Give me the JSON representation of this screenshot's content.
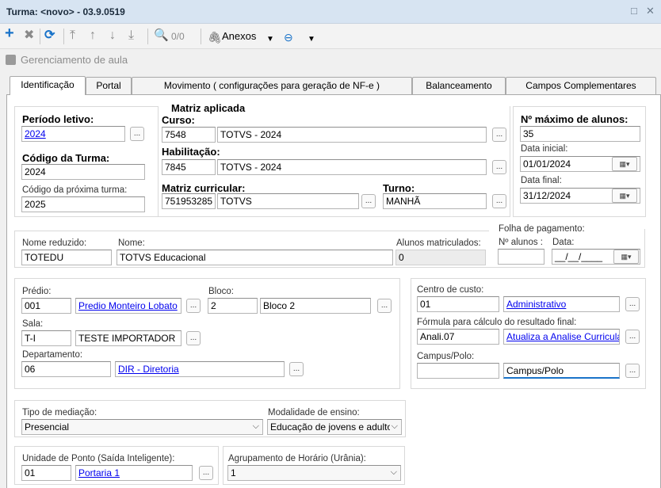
{
  "window": {
    "title": "Turma: <novo> - 03.9.0519",
    "restore_glyph": "□",
    "close_glyph": "✕"
  },
  "toolbar": {
    "add_icon": "plus-icon",
    "page_count": "0/0",
    "anexos_label": "Anexos",
    "colors": {
      "add": "#1a73c9",
      "refresh": "#1a73c9",
      "disabled": "#8a8a8a"
    }
  },
  "breadcrumb": {
    "text": "Gerenciamento de aula"
  },
  "tabs": [
    {
      "label": "Identificação",
      "active": true
    },
    {
      "label": "Portal"
    },
    {
      "label": "Movimento ( configurações para geração de NF-e )"
    },
    {
      "label": "Balanceamento"
    },
    {
      "label": "Campos Complementares"
    }
  ],
  "periodo": {
    "label": "Período letivo:",
    "value": "2024",
    "codigo_label": "Código da Turma:",
    "codigo_value": "2024",
    "proxima_label": "Código da próxima turma:",
    "proxima_value": "2025"
  },
  "matriz": {
    "legend": "Matriz aplicada",
    "curso_label": "Curso:",
    "curso_code": "7548",
    "curso_name": "TOTVS - 2024",
    "habilitacao_label": "Habilitação:",
    "habilitacao_code": "7845",
    "habilitacao_name": "TOTVS - 2024",
    "matriz_label": "Matriz curricular:",
    "matriz_code": "751953285",
    "matriz_name": "TOTVS",
    "turno_label": "Turno:",
    "turno_value": "MANHÃ"
  },
  "alunos": {
    "max_label": "Nº máximo de alunos:",
    "max_value": "35",
    "data_inicial_label": "Data inicial:",
    "data_inicial": "01/01/2024",
    "data_final_label": "Data final:",
    "data_final": "31/12/2024"
  },
  "nome": {
    "reduzido_label": "Nome reduzido:",
    "reduzido_value": "TOTEDU",
    "nome_label": "Nome:",
    "nome_value": "TOTVS Educacional",
    "matriculados_label": "Alunos matriculados:",
    "matriculados_value": "0"
  },
  "folha": {
    "legend": "Folha de pagamento:",
    "alunos_label": "Nº alunos :",
    "alunos_value": "",
    "data_label": "Data:",
    "data_value": "__/__/____"
  },
  "local": {
    "predio_label": "Prédio:",
    "predio_code": "001",
    "predio_name": "Predio Monteiro Lobato",
    "bloco_label": "Bloco:",
    "bloco_code": "2",
    "bloco_name": "Bloco 2",
    "sala_label": "Sala:",
    "sala_code": "T-I",
    "sala_name": "TESTE IMPORTADOR",
    "departamento_label": "Departamento:",
    "departamento_code": "06",
    "departamento_name": "DIR - Diretoria"
  },
  "centro": {
    "centro_label": "Centro de custo:",
    "centro_code": "01",
    "centro_name": "Administrativo",
    "formula_label": "Fórmula para cálculo do resultado final:",
    "formula_code": "Anali.07",
    "formula_name": "Atualiza a Analise Curricular c",
    "campus_label": "Campus/Polo:",
    "campus_code": "",
    "campus_name": "Campus/Polo"
  },
  "mediacao": {
    "tipo_label": "Tipo de mediação:",
    "tipo_value": "Presencial",
    "modalidade_label": "Modalidade de ensino:",
    "modalidade_value": "Educação de jovens e adultos"
  },
  "ponto": {
    "unidade_label": "Unidade de Ponto (Saída Inteligente):",
    "unidade_code": "01",
    "unidade_name": "Portaria 1",
    "agrupamento_label": "Agrupamento de Horário (Urânia):",
    "agrupamento_value": "1"
  }
}
